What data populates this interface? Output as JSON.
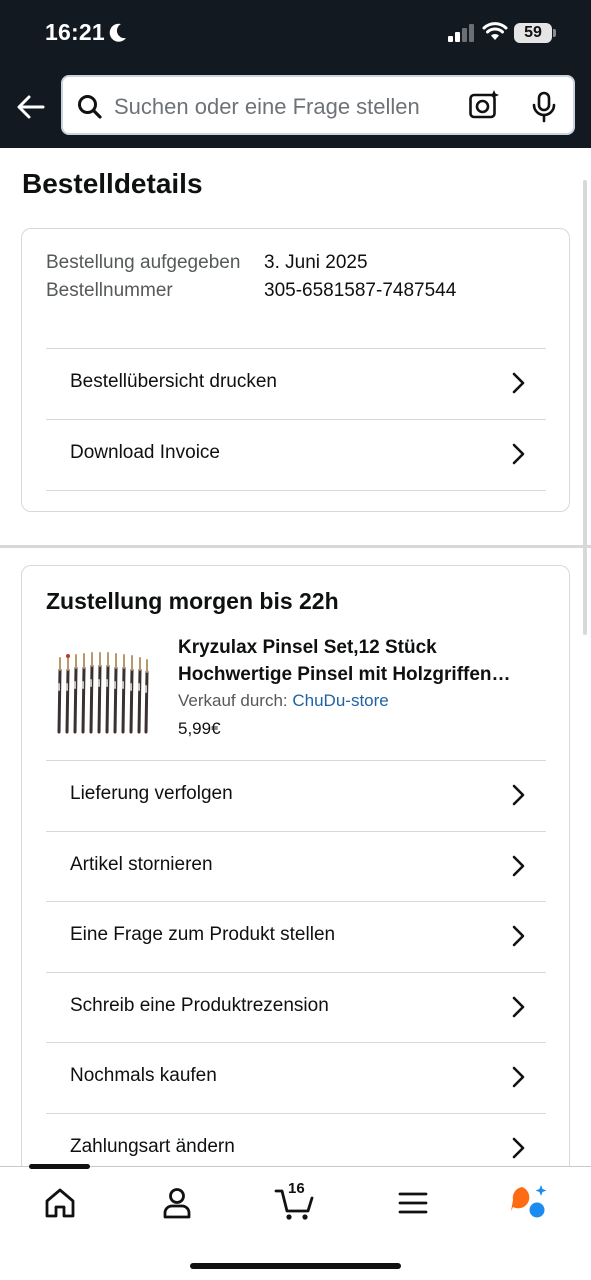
{
  "status_bar": {
    "time": "16:21",
    "battery": "59"
  },
  "search": {
    "placeholder": "Suchen oder eine Frage stellen"
  },
  "page": {
    "title": "Bestelldetails"
  },
  "order": {
    "label": "Bestellung aufgegeben Bestellnummer",
    "date": "3. Juni 2025",
    "number": "305-6581587-7487544"
  },
  "order_actions": [
    {
      "label": "Bestellübersicht drucken"
    },
    {
      "label": "Download Invoice"
    }
  ],
  "delivery": {
    "title": "Zustellung morgen bis 22h",
    "product": {
      "title_line1": "Kryzulax Pinsel Set,12 Stück",
      "title_line2": "Hochwertige Pinsel mit Holzgriffen…",
      "seller_label": "Verkauf durch:",
      "seller_name": "ChuDu-store",
      "price": "5,99€"
    }
  },
  "item_actions": [
    {
      "label": "Lieferung verfolgen"
    },
    {
      "label": "Artikel stornieren"
    },
    {
      "label": "Eine Frage zum Produkt stellen"
    },
    {
      "label": "Schreib eine Produktrezension"
    },
    {
      "label": "Nochmals kaufen"
    },
    {
      "label": "Zahlungsart ändern"
    }
  ],
  "bottom_nav": {
    "items": [
      "home-icon",
      "account-icon",
      "cart-icon",
      "menu-icon",
      "rufus-icon"
    ],
    "cart_count": "16"
  },
  "colors": {
    "header_bg": "#131921",
    "link": "#2162a1",
    "rufus_orange": "#ff6a14",
    "rufus_blue": "#1a8cf0"
  }
}
